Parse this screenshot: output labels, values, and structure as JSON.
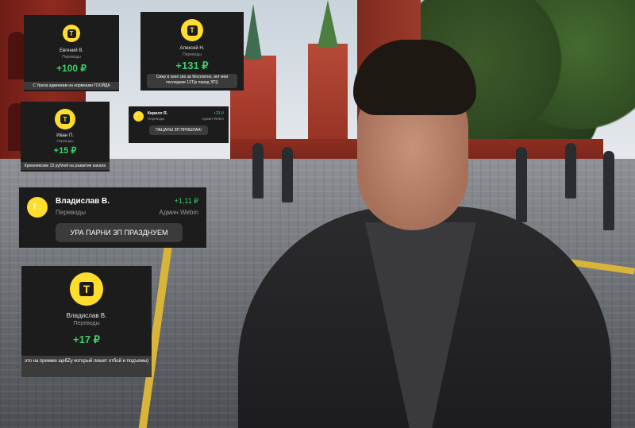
{
  "brand": {
    "accent": "#ffdd2d",
    "card_bg": "#1c1c1c",
    "positive": "#39d16a",
    "logo_glyph": "T"
  },
  "cards": [
    {
      "name": "Евгений В.",
      "category": "Переводы",
      "amount": "+100 ₽",
      "message": "С Урала админкам на нормешки ГООЙДА"
    },
    {
      "name": "Алексей Н.",
      "category": "Переводы",
      "amount": "+131 ₽",
      "message": "Сижу в зоне сво за бесплатно, вот мои последние 13Т(р перед ЗП))"
    },
    {
      "name": "Иван П.",
      "category": "Переводы",
      "amount": "+15 ₽",
      "message": "Кремлевские 15 рублей на развитие канала"
    },
    {
      "name": "Кирилл Я.",
      "category": "Переводы",
      "amount": "+23 ₽",
      "recipient": "Админ Webm",
      "message": "ПАЦАНЫ ЗП ПРИШЛАА!"
    },
    {
      "name": "Владислав В.",
      "category": "Переводы",
      "amount": "+1,11 ₽",
      "recipient": "Админ Webm",
      "message": "УРА ПАРНИ ЗП ПРАЗДНУЕМ"
    },
    {
      "name": "Владислав В.",
      "category": "Переводы",
      "amount": "+17 ₽",
      "message": "это на премию щебZy который пишет отбой и подъемы)"
    }
  ]
}
